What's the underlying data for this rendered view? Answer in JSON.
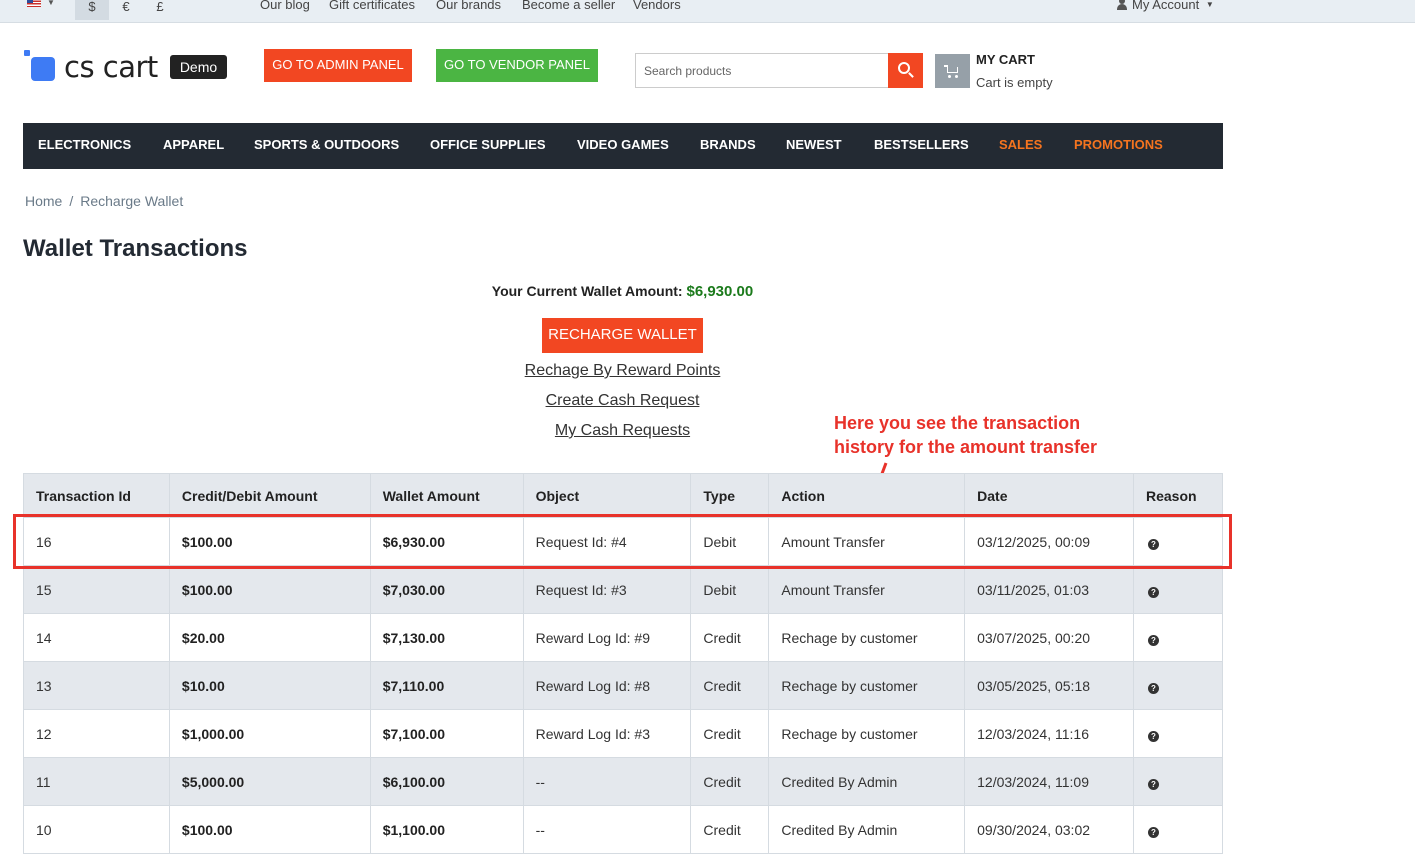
{
  "topbar": {
    "currencies": [
      "$",
      "€",
      "£"
    ],
    "links": [
      "Our blog",
      "Gift certificates",
      "Our brands",
      "Become a seller",
      "Vendors"
    ],
    "account": "My Account"
  },
  "header": {
    "logo_text": "cs cart",
    "demo_badge": "Demo",
    "admin_button": "GO TO ADMIN PANEL",
    "vendor_button": "GO TO VENDOR PANEL",
    "search_placeholder": "Search products",
    "cart_title": "MY CART",
    "cart_status": "Cart is empty"
  },
  "menu": [
    "ELECTRONICS",
    "APPAREL",
    "SPORTS & OUTDOORS",
    "OFFICE SUPPLIES",
    "VIDEO GAMES",
    "BRANDS",
    "NEWEST",
    "BESTSELLERS",
    "SALES",
    "PROMOTIONS"
  ],
  "breadcrumb": {
    "home": "Home",
    "sep": "/",
    "current": "Recharge Wallet"
  },
  "page_title": "Wallet Transactions",
  "wallet": {
    "label": "Your Current Wallet Amount:",
    "amount": "$6,930.00",
    "recharge_button": "RECHARGE WALLET",
    "links": [
      "Rechage By Reward Points",
      "Create Cash Request",
      "My Cash Requests"
    ]
  },
  "annotation": {
    "line1": "Here you see the transaction",
    "line2": "history for the amount transfer"
  },
  "table": {
    "headers": [
      "Transaction Id",
      "Credit/Debit Amount",
      "Wallet Amount",
      "Object",
      "Type",
      "Action",
      "Date",
      "Reason"
    ],
    "rows": [
      {
        "id": "16",
        "amount": "$100.00",
        "wallet": "$6,930.00",
        "object": "Request Id: #4",
        "type": "Debit",
        "action": "Amount Transfer",
        "date": "03/12/2025, 00:09"
      },
      {
        "id": "15",
        "amount": "$100.00",
        "wallet": "$7,030.00",
        "object": "Request Id: #3",
        "type": "Debit",
        "action": "Amount Transfer",
        "date": "03/11/2025, 01:03"
      },
      {
        "id": "14",
        "amount": "$20.00",
        "wallet": "$7,130.00",
        "object": "Reward Log Id: #9",
        "type": "Credit",
        "action": "Rechage by customer",
        "date": "03/07/2025, 00:20"
      },
      {
        "id": "13",
        "amount": "$10.00",
        "wallet": "$7,110.00",
        "object": "Reward Log Id: #8",
        "type": "Credit",
        "action": "Rechage by customer",
        "date": "03/05/2025, 05:18"
      },
      {
        "id": "12",
        "amount": "$1,000.00",
        "wallet": "$7,100.00",
        "object": "Reward Log Id: #3",
        "type": "Credit",
        "action": "Rechage by customer",
        "date": "12/03/2024, 11:16"
      },
      {
        "id": "11",
        "amount": "$5,000.00",
        "wallet": "$6,100.00",
        "object": "--",
        "type": "Credit",
        "action": "Credited By Admin",
        "date": "12/03/2024, 11:09"
      },
      {
        "id": "10",
        "amount": "$100.00",
        "wallet": "$1,100.00",
        "object": "--",
        "type": "Credit",
        "action": "Credited By Admin",
        "date": "09/30/2024, 03:02"
      }
    ],
    "reason_icon": "question-circle-icon"
  },
  "colors": {
    "accent": "#f24722",
    "vendor_green": "#4bb543",
    "menu_bg": "#232a33",
    "debit": "#d11a1a",
    "credit": "#1b8a1b",
    "annotation": "#e8322a"
  }
}
